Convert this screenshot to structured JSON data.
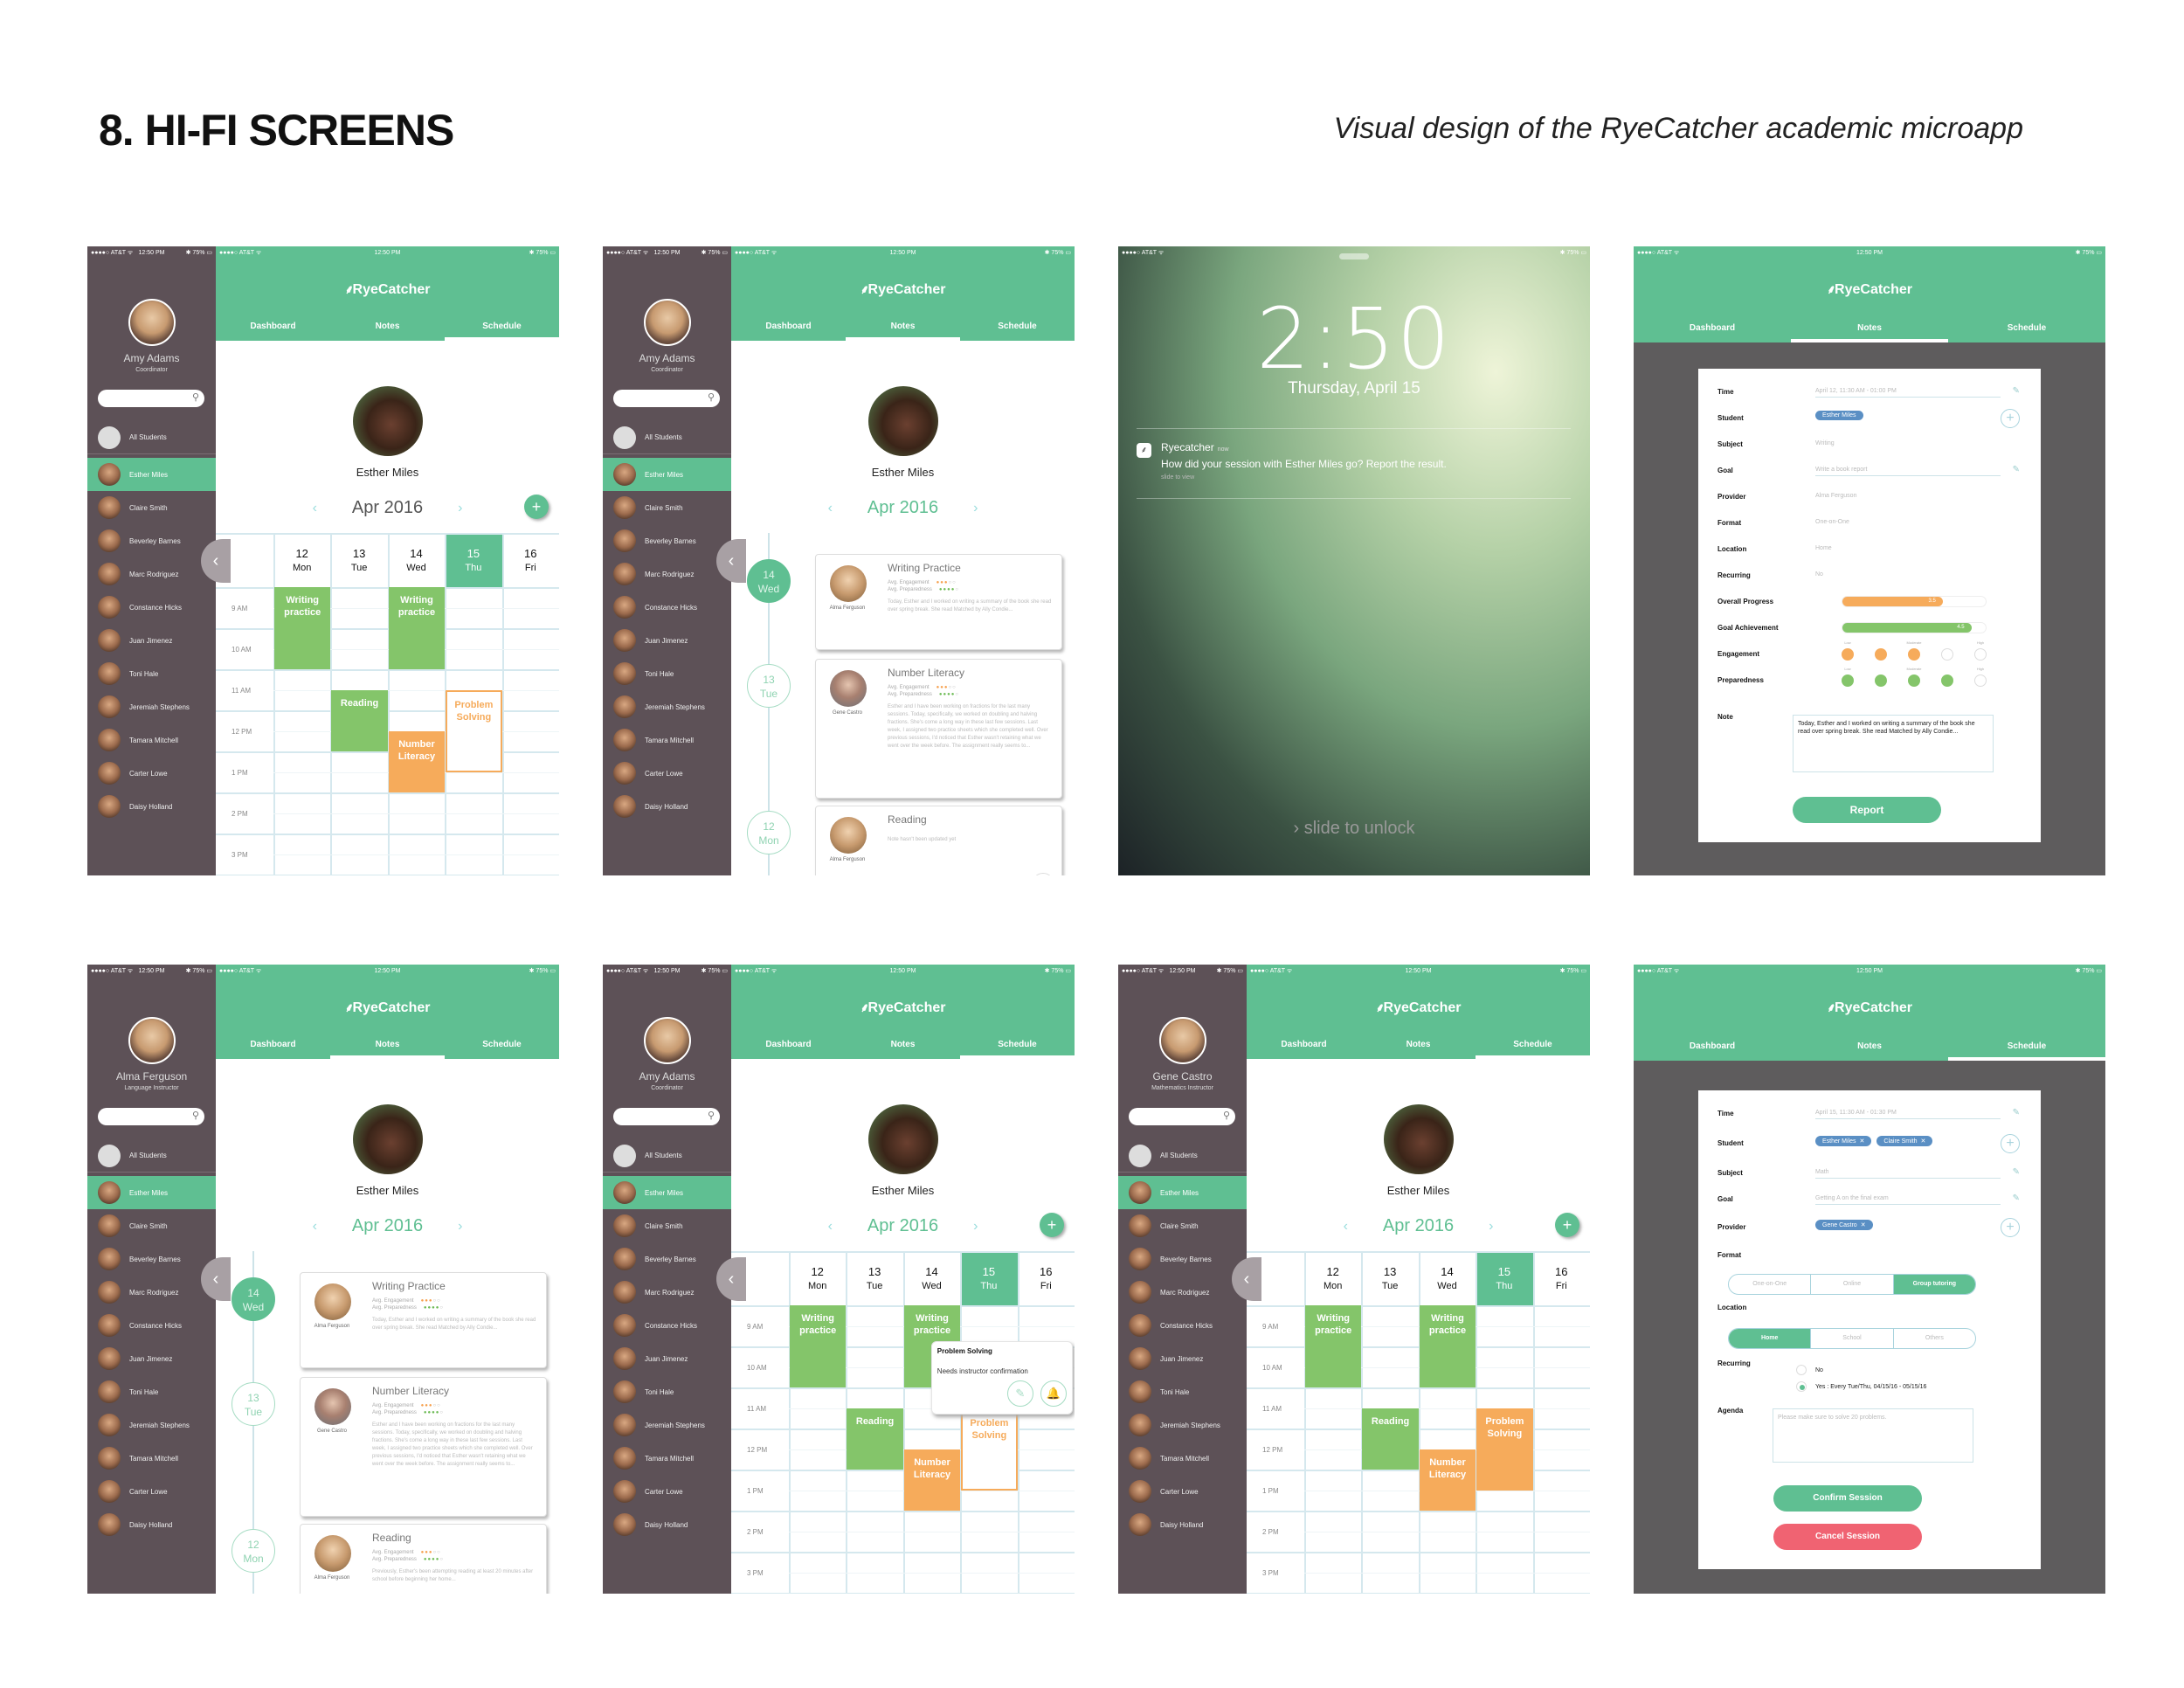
{
  "page": {
    "title": "8. HI-FI SCREENS",
    "subtitle": "Visual design of the RyeCatcher academic microapp"
  },
  "status_bar": {
    "carrier": "●●●●○ AT&T ᯤ",
    "time": "12:50 PM",
    "battery": "✱ 75% ▭"
  },
  "app": {
    "name": "RyeCatcher",
    "logo_icon": "wheat-icon"
  },
  "tabs": [
    "Dashboard",
    "Notes",
    "Schedule"
  ],
  "users": {
    "amy": {
      "name": "Amy Adams",
      "role": "Coordinator"
    },
    "alma": {
      "name": "Alma Ferguson",
      "role": "Language Instructor"
    },
    "gene": {
      "name": "Gene Castro",
      "role": "Mathematics Instructor"
    }
  },
  "sidebar": {
    "all_students": "All Students",
    "students": [
      "Esther Miles",
      "Claire Smith",
      "Beverley Barnes",
      "Marc Rodriguez",
      "Constance Hicks",
      "Juan Jimenez",
      "Toni Hale",
      "Jeremiah Stephens",
      "Tamara Mitchell",
      "Carter Lowe",
      "Daisy Holland"
    ],
    "selected": "Esther Miles"
  },
  "student_header": {
    "name": "Esther Miles",
    "month": "Apr 2016",
    "prev": "‹",
    "next": "›",
    "add": "+"
  },
  "calendar": {
    "days": [
      {
        "num": "12",
        "name": "Mon"
      },
      {
        "num": "13",
        "name": "Tue"
      },
      {
        "num": "14",
        "name": "Wed"
      },
      {
        "num": "15",
        "name": "Thu",
        "today": true
      },
      {
        "num": "16",
        "name": "Fri"
      }
    ],
    "times": [
      "9 AM",
      "10 AM",
      "11 AM",
      "12 PM",
      "1 PM",
      "2 PM",
      "3 PM"
    ],
    "events": [
      {
        "title": "Writing practice",
        "day": 0,
        "start": 8.5,
        "end": 10.5,
        "color": "green"
      },
      {
        "title": "Writing practice",
        "day": 2,
        "start": 8.5,
        "end": 10.5,
        "color": "green"
      },
      {
        "title": "Reading",
        "day": 1,
        "start": 11.0,
        "end": 12.5,
        "color": "green"
      },
      {
        "title": "Number Literacy",
        "day": 2,
        "start": 12.0,
        "end": 13.5,
        "color": "orange"
      },
      {
        "title": "Problem Solving",
        "day": 3,
        "start": 11.0,
        "end": 13.0,
        "color": "outline"
      }
    ]
  },
  "popup": {
    "title": "Problem Solving",
    "message": "Needs instructor confirmation",
    "edit_icon": "✎",
    "bell_icon": "🔔"
  },
  "notes": {
    "entries": [
      {
        "day_num": "14",
        "day_name": "Wed",
        "active": true,
        "title": "Writing Practice",
        "provider": "Alma Ferguson",
        "engagement_label": "Avg. Engagement",
        "engagement": 3,
        "preparedness_label": "Avg. Preparedness",
        "preparedness": 4,
        "text": "Today, Esther and I worked on writing a summary of the book she read over spring break. She read Matched by Ally Condie..."
      },
      {
        "day_num": "13",
        "day_name": "Tue",
        "active": false,
        "title": "Number Literacy",
        "provider": "Gene Castro",
        "engagement_label": "Avg. Engagement",
        "engagement": 3,
        "preparedness_label": "Avg. Preparedness",
        "preparedness": 4,
        "text": "Esther and I have been working on fractions for the last many sessions. Today, specifically, we worked on doubling and halving fractions. She's come a long way in these last few sessions. Last week, I assigned two practice sheets which she completed well. Over previous sessions, I'd noticed that Esther wasn't retaining what we went over the week before. The assignment really seems to..."
      },
      {
        "day_num": "12",
        "day_name": "Mon",
        "active": false,
        "title": "Reading",
        "provider": "Alma Ferguson",
        "pending_text": "Note hasn't been updated yet",
        "engagement_label": "Avg. Engagement",
        "engagement": 3,
        "preparedness_label": "Avg. Preparedness",
        "preparedness": 4,
        "text": "Previously, Esther's been attempting reading at least 20 minutes after school before beginning her home..."
      }
    ]
  },
  "lock_screen": {
    "carrier": "●●●●○ AT&T ᯤ",
    "battery": "✱ 75% ▭",
    "time": "2:50",
    "date": "Thursday, April 15",
    "notification": {
      "app": "Ryecatcher",
      "when": "now",
      "message": "How did your session with Esther Miles go? Report the result.",
      "hint": "slide to view"
    },
    "unlock": "› slide to unlock"
  },
  "report_form": {
    "fields": [
      {
        "label": "Time",
        "value": "April 12, 11:30 AM - 01:00 PM"
      },
      {
        "label": "Student",
        "value": "Esther Miles"
      },
      {
        "label": "Subject",
        "value": "Writing"
      },
      {
        "label": "Goal",
        "value": "Write a book report"
      },
      {
        "label": "Provider",
        "value": "Alma Ferguson"
      },
      {
        "label": "Format",
        "value": "One-on-One"
      },
      {
        "label": "Location",
        "value": "Home"
      },
      {
        "label": "Recurring",
        "value": "No"
      }
    ],
    "overall_progress": {
      "label": "Overall Progress",
      "value": 3.5,
      "max": 5,
      "color": "#f6ab5b"
    },
    "goal_achievement": {
      "label": "Goal Achievement",
      "value": 4.5,
      "max": 5,
      "color": "#84c56a"
    },
    "engagement": {
      "label": "Engagement",
      "value": 3,
      "max": 5
    },
    "preparedness": {
      "label": "Preparedness",
      "value": 4,
      "max": 5
    },
    "scale_labels": [
      "Low",
      "Moderate",
      "High"
    ],
    "note_label": "Note",
    "note": "Today, Esther and I worked on writing a summary of the book she read over spring break. She read Matched by Ally Condie...",
    "submit": "Report"
  },
  "session_form": {
    "time_label": "Time",
    "time": "April 15, 11:30 AM - 01:30 PM",
    "student_label": "Student",
    "students": [
      "Esther Miles",
      "Claire Smith"
    ],
    "subject_label": "Subject",
    "subject": "Math",
    "goal_label": "Goal",
    "goal": "Getting A on the final exam",
    "provider_label": "Provider",
    "providers": [
      "Gene Castro"
    ],
    "format_label": "Format",
    "format_options": [
      "One-on-One",
      "Online",
      "Group tutoring"
    ],
    "format_selected": "Group tutoring",
    "location_label": "Location",
    "location_options": [
      "Home",
      "School",
      "Others"
    ],
    "location_selected": "Home",
    "recurring_label": "Recurring",
    "recurring_no": "No",
    "recurring_yes": "Yes : Every Tue/Thu, 04/15/16 - 05/15/16",
    "recurring_selected": "yes",
    "agenda_label": "Agenda",
    "agenda_placeholder": "Please make sure to solve 20 problems.",
    "confirm": "Confirm Session",
    "cancel": "Cancel Session"
  },
  "colors": {
    "brand_green": "#5fbf92",
    "sidebar": "#5d5157",
    "event_green": "#84c56a",
    "event_orange": "#f6ab5b",
    "chip_blue": "#5a8fc4",
    "cancel_red": "#f06372"
  }
}
